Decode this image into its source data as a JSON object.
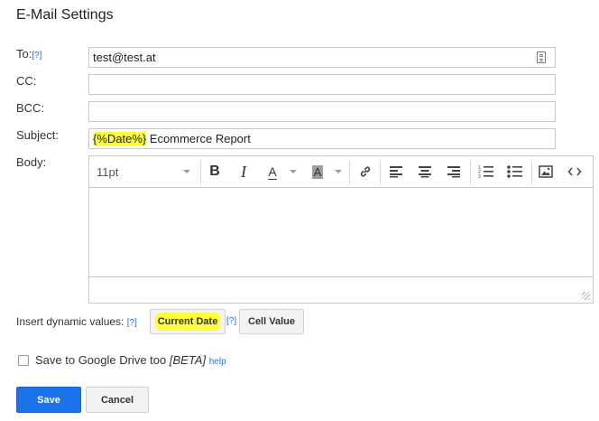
{
  "dialog": {
    "title": "E-Mail Settings"
  },
  "fields": {
    "to": {
      "label": "To:",
      "help": "[?]",
      "value": "test@test.at"
    },
    "cc": {
      "label": "CC:",
      "value": ""
    },
    "bcc": {
      "label": "BCC:",
      "value": ""
    },
    "subject": {
      "label": "Subject:",
      "token": "{%Date%}",
      "value": " Ecommerce Report"
    },
    "body": {
      "label": "Body:"
    }
  },
  "editor": {
    "font_size": "11pt",
    "tools": [
      "bold-icon",
      "italic-icon",
      "font-color-icon",
      "highlight-color-icon",
      "link-icon",
      "align-left-icon",
      "align-center-icon",
      "align-right-icon",
      "ordered-list-icon",
      "bullet-list-icon",
      "image-icon",
      "source-code-icon"
    ],
    "bold_glyph": "B",
    "italic_glyph": "I",
    "font_color_glyph": "A",
    "highlight_glyph": "A"
  },
  "dynamic": {
    "label": "Insert dynamic values:",
    "help1": "[?]",
    "current_date": "Current Date",
    "help2": "[?]",
    "cell_value": "Cell Value"
  },
  "drive": {
    "label": "Save to Google Drive too",
    "beta": "[BETA]",
    "help": "help",
    "checked": false
  },
  "actions": {
    "save": "Save",
    "cancel": "Cancel",
    "accent": "#1a73e8",
    "highlight": "#ffff3b"
  }
}
